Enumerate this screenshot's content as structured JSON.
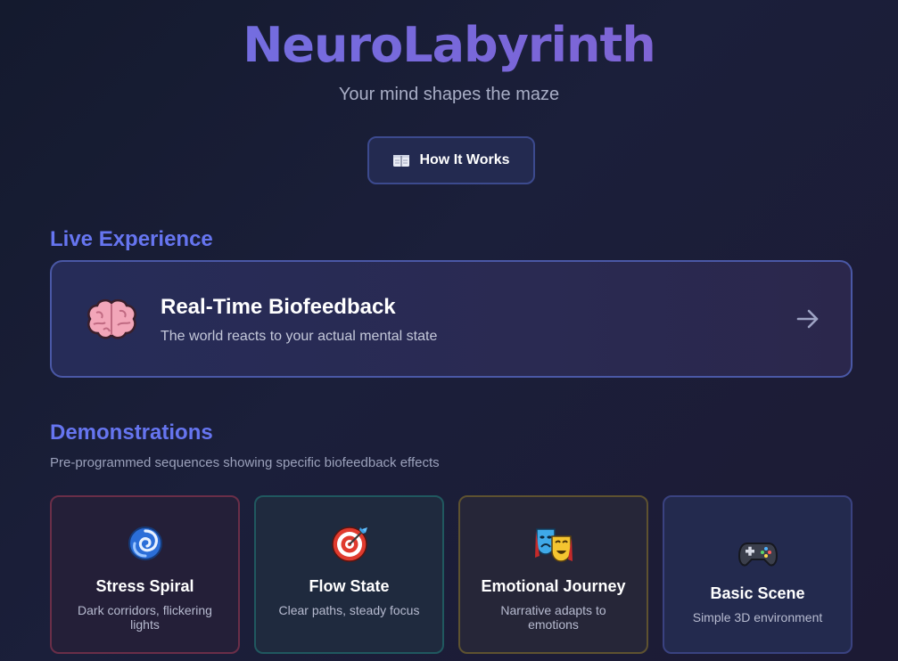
{
  "hero": {
    "title": "NeuroLabyrinth",
    "subtitle": "Your mind shapes the maze",
    "how_button": {
      "label": "How It Works",
      "icon": "book-icon"
    }
  },
  "live": {
    "section_title": "Live Experience",
    "card": {
      "title": "Real-Time Biofeedback",
      "description": "The world reacts to your actual mental state",
      "icon": "brain-icon",
      "action_icon": "arrow-right-icon"
    }
  },
  "demonstrations": {
    "section_title": "Demonstrations",
    "description": "Pre-programmed sequences showing specific biofeedback effects",
    "cards": [
      {
        "title": "Stress Spiral",
        "description": "Dark corridors, flickering lights",
        "icon": "cyclone-icon"
      },
      {
        "title": "Flow State",
        "description": "Clear paths, steady focus",
        "icon": "target-icon"
      },
      {
        "title": "Emotional Journey",
        "description": "Narrative adapts to emotions",
        "icon": "theater-masks-icon"
      },
      {
        "title": "Basic Scene",
        "description": "Simple 3D environment",
        "icon": "gamepad-icon"
      }
    ]
  },
  "colors": {
    "accent": "#6675f0",
    "title_gradient_start": "#6f73e6",
    "title_gradient_end": "#8a63d0",
    "background": "#1b1f3a"
  }
}
